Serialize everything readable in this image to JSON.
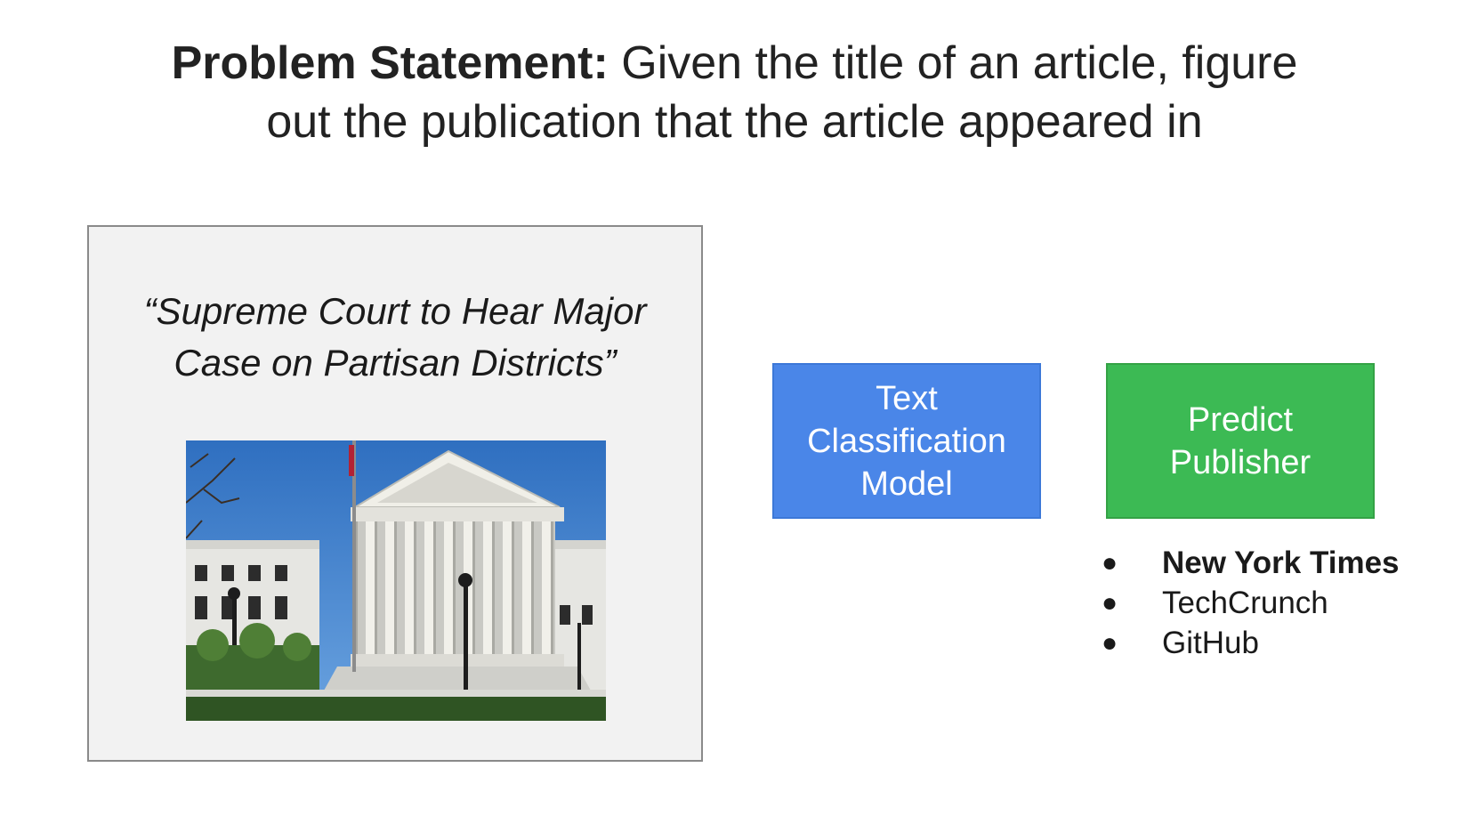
{
  "title": {
    "bold_part": "Problem Statement:",
    "rest_line1": " Given the title of an article, figure",
    "rest_line2": "out the publication that the article appeared in"
  },
  "article": {
    "headline_line1": "“Supreme Court to Hear Major",
    "headline_line2": "Case on Partisan Districts”"
  },
  "model_box": {
    "line1": "Text",
    "line2": "Classification",
    "line3": "Model",
    "color": "#4a86e8"
  },
  "predict_box": {
    "line1": "Predict",
    "line2": "Publisher",
    "color": "#3cba54"
  },
  "publishers": [
    {
      "label": "New York Times",
      "bullet": "●"
    },
    {
      "label": "TechCrunch",
      "bullet": "●"
    },
    {
      "label": "GitHub",
      "bullet": "●"
    }
  ]
}
